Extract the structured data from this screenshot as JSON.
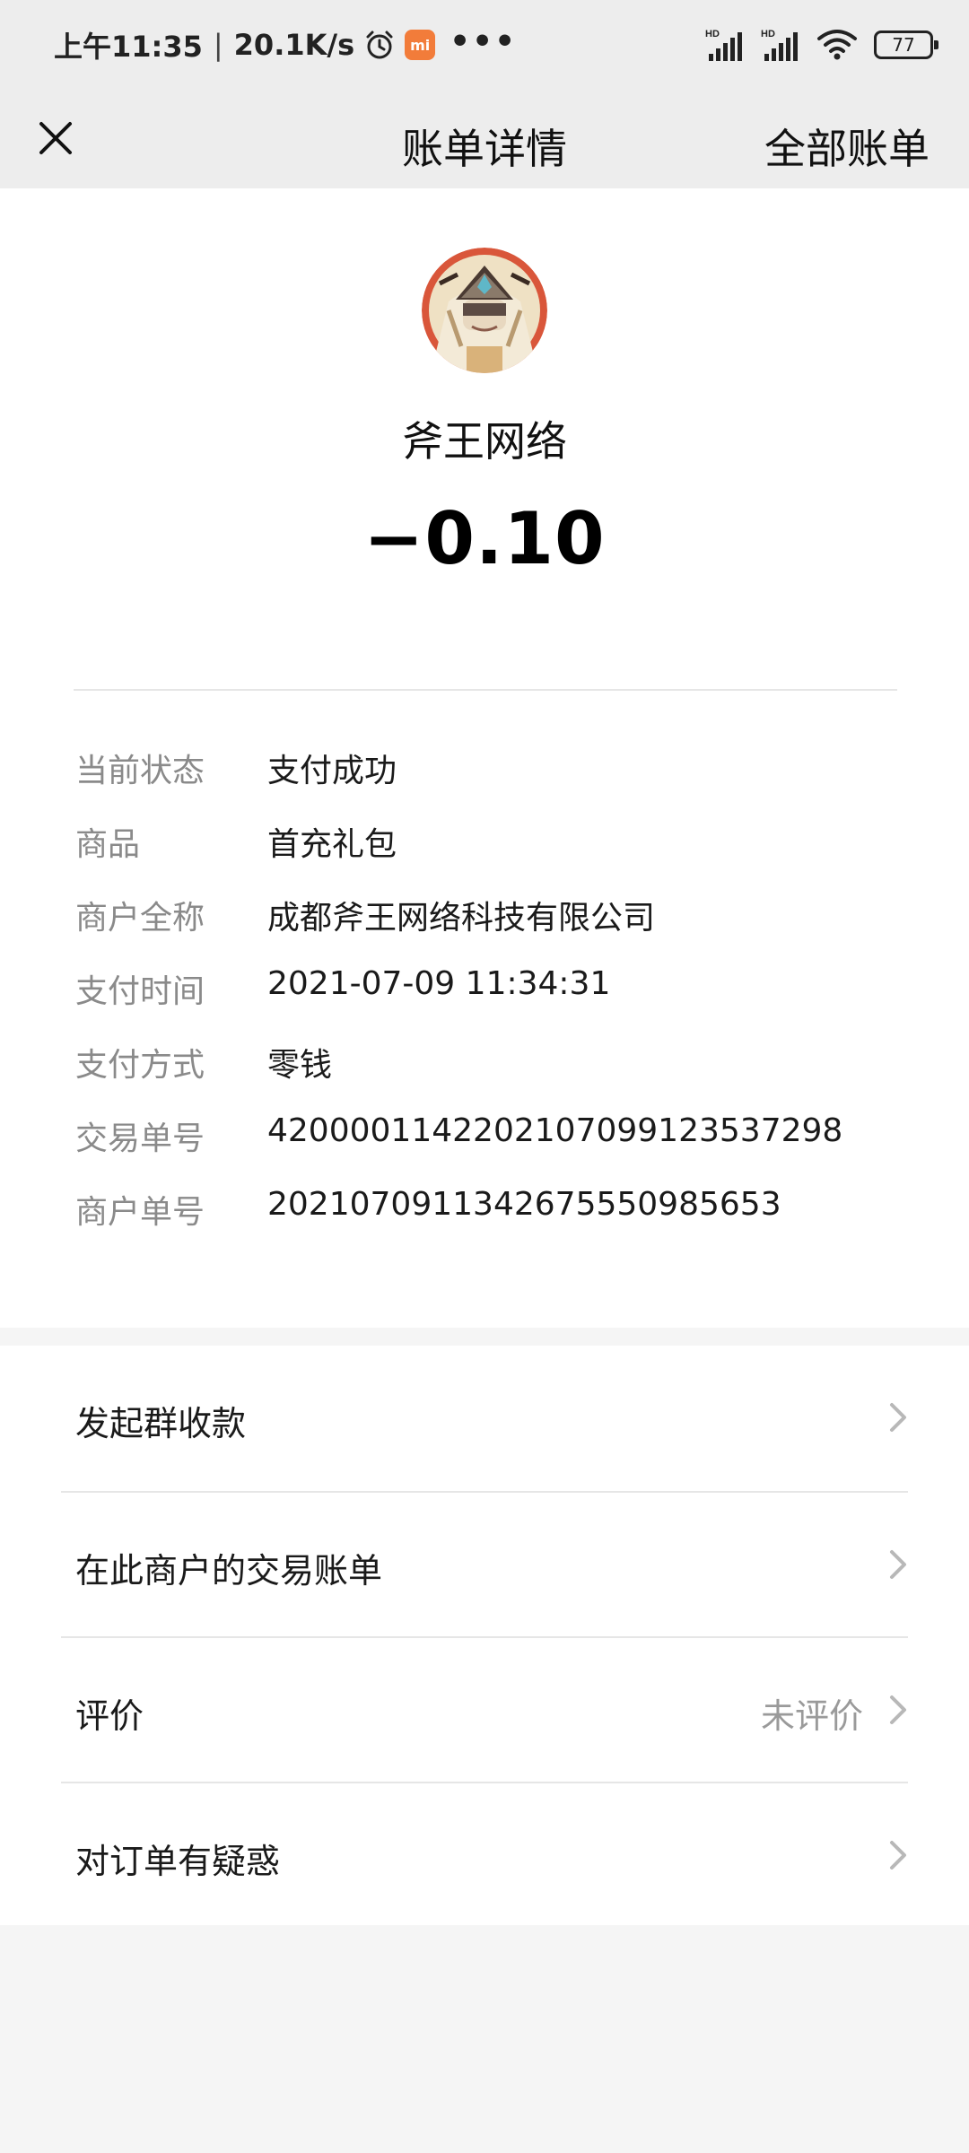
{
  "status_bar": {
    "time": "上午11:35",
    "separator": "|",
    "net_speed": "20.1K/s",
    "battery_level": "77",
    "icons": [
      "alarm-icon",
      "mi-app-icon",
      "more-dots-icon",
      "hd-signal-icon",
      "hd-signal-icon",
      "wifi-icon",
      "battery-icon"
    ]
  },
  "nav": {
    "close_icon": "close-icon",
    "title": "账单详情",
    "action_label": "全部账单"
  },
  "bill": {
    "merchant_name": "斧王网络",
    "amount": "−0.10",
    "details": [
      {
        "label": "当前状态",
        "value": "支付成功"
      },
      {
        "label": "商品",
        "value": "首充礼包"
      },
      {
        "label": "商户全称",
        "value": "成都斧王网络科技有限公司"
      },
      {
        "label": "支付时间",
        "value": "2021-07-09 11:34:31"
      },
      {
        "label": "支付方式",
        "value": "零钱"
      },
      {
        "label": "交易单号",
        "value": "4200001142202107099123537298"
      },
      {
        "label": "商户单号",
        "value": "20210709113426755509856​53"
      }
    ]
  },
  "actions": [
    {
      "label": "发起群收款",
      "extra": ""
    },
    {
      "label": "在此商户的交易账单",
      "extra": ""
    },
    {
      "label": "评价",
      "extra": "未评价"
    },
    {
      "label": "对订单有疑惑",
      "extra": ""
    }
  ],
  "colors": {
    "header_bg": "#ededed",
    "page_bg": "#f5f5f5",
    "card_bg": "#ffffff",
    "label_gray": "#8a8a8a",
    "mi_orange": "#f27c3a"
  }
}
